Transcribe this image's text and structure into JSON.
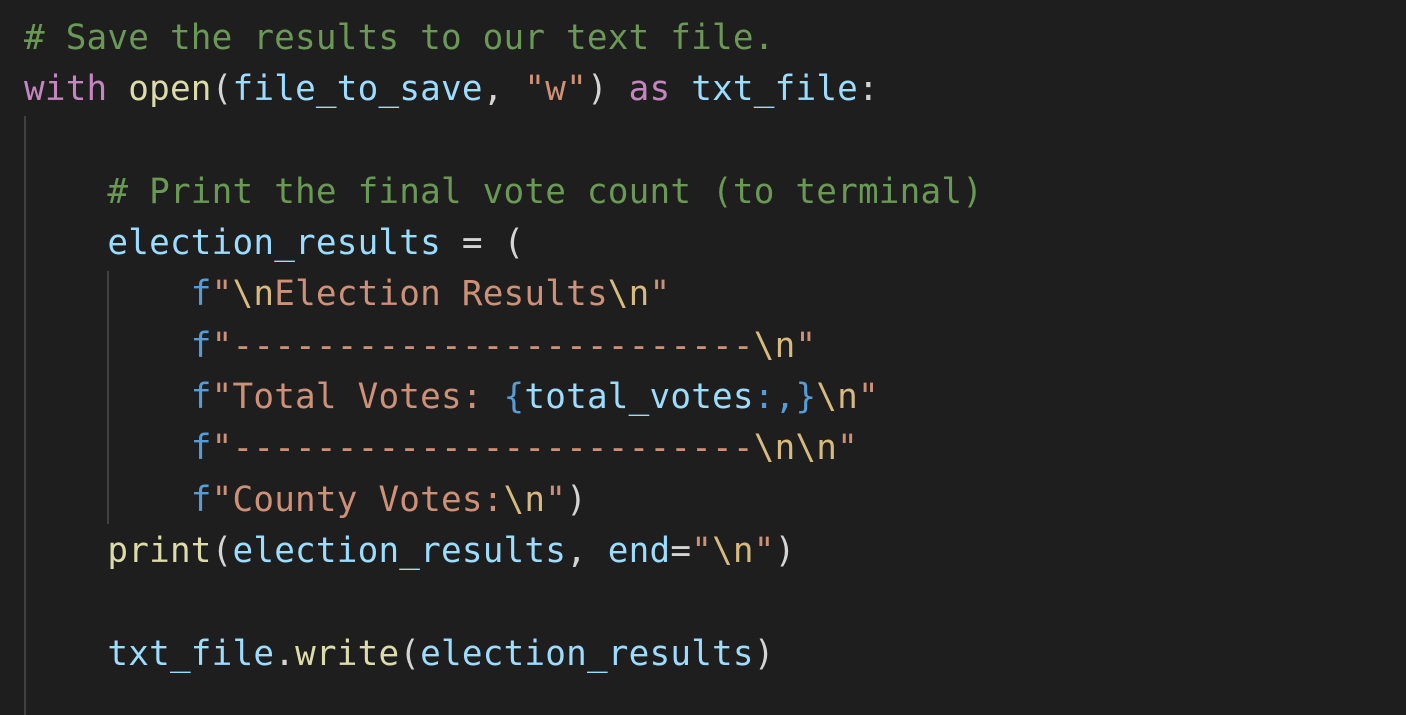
{
  "editor": {
    "theme_colors": {
      "background": "#1e1e1e",
      "comment": "#6a9955",
      "keyword": "#c586c0",
      "function": "#dcdcaa",
      "variable": "#9cdcfe",
      "string": "#ce9178",
      "escape": "#d7ba7d",
      "fstring_prefix": "#569cd6",
      "punctuation": "#d4d4d4",
      "indent_guide": "#404040"
    },
    "lines": [
      {
        "id": "comment-save",
        "tokens": [
          {
            "t": "comment",
            "v": "# Save the results to our text file."
          }
        ]
      },
      {
        "id": "with-open",
        "tokens": [
          {
            "t": "kw",
            "v": "with"
          },
          {
            "t": "punc",
            "v": " "
          },
          {
            "t": "fn",
            "v": "open"
          },
          {
            "t": "punc",
            "v": "("
          },
          {
            "t": "var",
            "v": "file_to_save"
          },
          {
            "t": "punc",
            "v": ", "
          },
          {
            "t": "str",
            "v": "\"w\""
          },
          {
            "t": "punc",
            "v": ") "
          },
          {
            "t": "kw",
            "v": "as"
          },
          {
            "t": "punc",
            "v": " "
          },
          {
            "t": "var",
            "v": "txt_file"
          },
          {
            "t": "punc",
            "v": ":"
          }
        ]
      },
      {
        "id": "blank-1",
        "tokens": []
      },
      {
        "id": "comment-print",
        "tokens": [
          {
            "t": "punc",
            "v": "    "
          },
          {
            "t": "comment",
            "v": "# Print the final vote count (to terminal)"
          }
        ]
      },
      {
        "id": "election-results-assign",
        "tokens": [
          {
            "t": "punc",
            "v": "    "
          },
          {
            "t": "var",
            "v": "election_results"
          },
          {
            "t": "punc",
            "v": " = ("
          }
        ]
      },
      {
        "id": "fstring-1",
        "tokens": [
          {
            "t": "punc",
            "v": "        "
          },
          {
            "t": "fpre",
            "v": "f"
          },
          {
            "t": "str",
            "v": "\""
          },
          {
            "t": "esc",
            "v": "\\n"
          },
          {
            "t": "str",
            "v": "Election Results"
          },
          {
            "t": "esc",
            "v": "\\n"
          },
          {
            "t": "str",
            "v": "\""
          }
        ]
      },
      {
        "id": "fstring-2",
        "tokens": [
          {
            "t": "punc",
            "v": "        "
          },
          {
            "t": "fpre",
            "v": "f"
          },
          {
            "t": "str",
            "v": "\"-------------------------"
          },
          {
            "t": "esc",
            "v": "\\n"
          },
          {
            "t": "str",
            "v": "\""
          }
        ]
      },
      {
        "id": "fstring-3",
        "tokens": [
          {
            "t": "punc",
            "v": "        "
          },
          {
            "t": "fpre",
            "v": "f"
          },
          {
            "t": "str",
            "v": "\"Total Votes: "
          },
          {
            "t": "brace",
            "v": "{"
          },
          {
            "t": "var",
            "v": "total_votes"
          },
          {
            "t": "brace",
            "v": ":,}"
          },
          {
            "t": "esc",
            "v": "\\n"
          },
          {
            "t": "str",
            "v": "\""
          }
        ]
      },
      {
        "id": "fstring-4",
        "tokens": [
          {
            "t": "punc",
            "v": "        "
          },
          {
            "t": "fpre",
            "v": "f"
          },
          {
            "t": "str",
            "v": "\"-------------------------"
          },
          {
            "t": "esc",
            "v": "\\n\\n"
          },
          {
            "t": "str",
            "v": "\""
          }
        ]
      },
      {
        "id": "fstring-5",
        "tokens": [
          {
            "t": "punc",
            "v": "        "
          },
          {
            "t": "fpre",
            "v": "f"
          },
          {
            "t": "str",
            "v": "\"County Votes:"
          },
          {
            "t": "esc",
            "v": "\\n"
          },
          {
            "t": "str",
            "v": "\""
          },
          {
            "t": "punc",
            "v": ")"
          }
        ]
      },
      {
        "id": "print-call",
        "tokens": [
          {
            "t": "punc",
            "v": "    "
          },
          {
            "t": "fn",
            "v": "print"
          },
          {
            "t": "punc",
            "v": "("
          },
          {
            "t": "var",
            "v": "election_results"
          },
          {
            "t": "punc",
            "v": ", "
          },
          {
            "t": "var",
            "v": "end"
          },
          {
            "t": "punc",
            "v": "="
          },
          {
            "t": "str",
            "v": "\""
          },
          {
            "t": "esc",
            "v": "\\n"
          },
          {
            "t": "str",
            "v": "\""
          },
          {
            "t": "punc",
            "v": ")"
          }
        ]
      },
      {
        "id": "blank-2",
        "tokens": []
      },
      {
        "id": "write-call",
        "tokens": [
          {
            "t": "punc",
            "v": "    "
          },
          {
            "t": "var",
            "v": "txt_file"
          },
          {
            "t": "punc",
            "v": "."
          },
          {
            "t": "fn",
            "v": "write"
          },
          {
            "t": "punc",
            "v": "("
          },
          {
            "t": "var",
            "v": "election_results"
          },
          {
            "t": "punc",
            "v": ")"
          }
        ]
      }
    ]
  }
}
